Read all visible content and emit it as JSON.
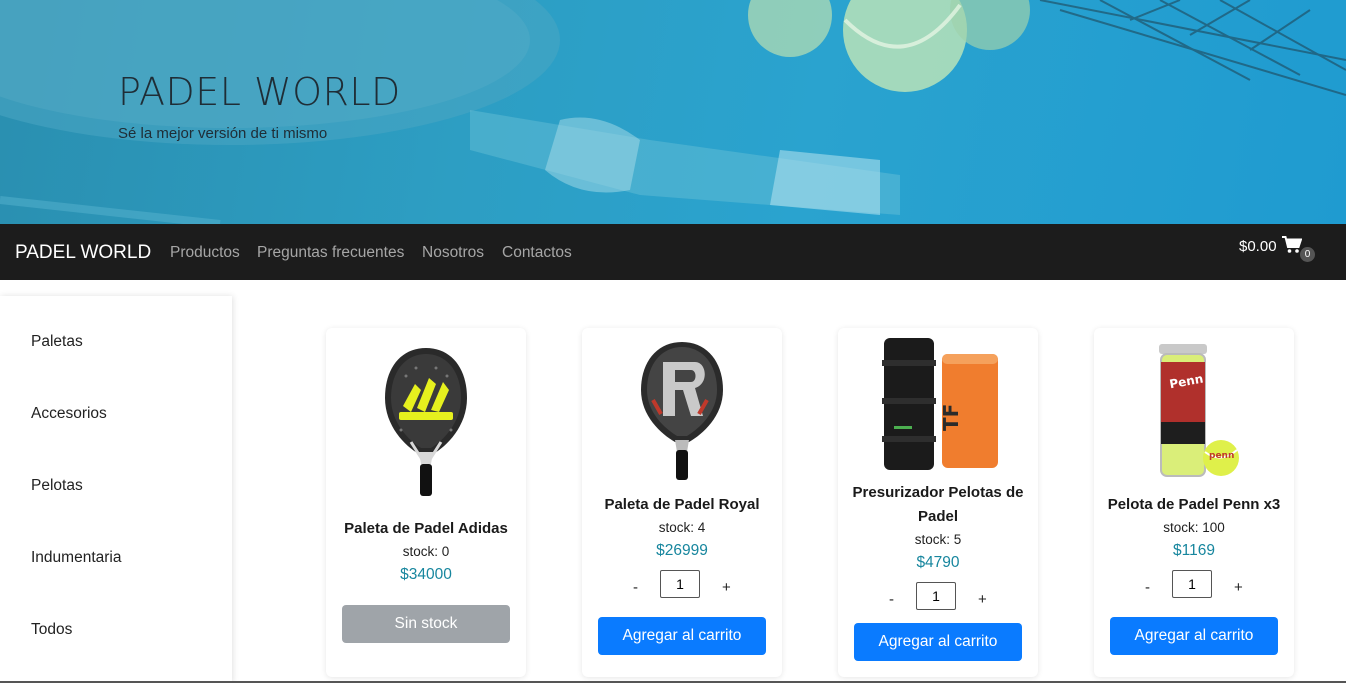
{
  "hero": {
    "title": "PADEL WORLD",
    "subtitle": "Sé la mejor versión de ti mismo"
  },
  "navbar": {
    "brand": "PADEL WORLD",
    "links": [
      "Productos",
      "Preguntas frecuentes",
      "Nosotros",
      "Contactos"
    ],
    "cart_total": "$0.00",
    "cart_count": "0",
    "cart_icon": "shopping-cart-icon"
  },
  "sidebar": {
    "items": [
      "Paletas",
      "Accesorios",
      "Pelotas",
      "Indumentaria",
      "Todos"
    ]
  },
  "products": [
    {
      "name": "Paleta de Padel Adidas",
      "stock": "stock: 0",
      "price": "$34000",
      "button": "Sin stock"
    },
    {
      "name": "Paleta de Padel Royal",
      "stock": "stock: 4",
      "price": "$26999",
      "qty_minus": "-",
      "qty_value": "1",
      "qty_plus": "+",
      "button": "Agregar al carrito"
    },
    {
      "name": "Presurizador Pelotas de Padel",
      "stock": "stock: 5",
      "price": "$4790",
      "qty_minus": "-",
      "qty_value": "1",
      "qty_plus": "+",
      "button": "Agregar al carrito"
    },
    {
      "name": "Pelota de Padel Penn x3",
      "stock": "stock: 100",
      "price": "$1169",
      "qty_minus": "-",
      "qty_value": "1",
      "qty_plus": "+",
      "button": "Agregar al carrito"
    }
  ],
  "colors": {
    "primary_button": "#0a7bff",
    "disabled_button": "#9fa4a9",
    "price": "#17869e",
    "navbar": "#1c1c1c"
  }
}
